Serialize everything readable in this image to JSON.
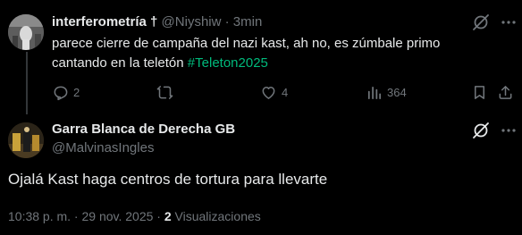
{
  "reply": {
    "display_name": "interferometría †",
    "handle": "@Niyshiw",
    "separator": "·",
    "time": "3min",
    "text_line1": "parece cierre de campaña del nazi kast, ah no, es zúmbale primo",
    "text_line2": "cantando en la teletón",
    "hashtag": "#Teleton2025",
    "actions": {
      "replies": "2",
      "retweets": "",
      "likes": "4",
      "views": "364"
    }
  },
  "main_post": {
    "display_name": "Garra Blanca de Derecha GB",
    "handle": "@MalvinasIngles",
    "text": "Ojalá Kast haga centros de tortura para llevarte",
    "timestamp": "10:38 p. m. · 29 nov. 2025 ·",
    "views_count": "2",
    "views_label": "Visualizaciones"
  },
  "colors": {
    "background": "#000000",
    "text": "#e7e9ea",
    "muted": "#71767b",
    "hashtag": "#00ba7c",
    "thread_line": "#333639"
  },
  "icons": {
    "grok": "grok-icon",
    "more": "more-options-icon",
    "reply": "reply-icon",
    "retweet": "retweet-icon",
    "like": "heart-icon",
    "views": "views-bar-icon",
    "bookmark": "bookmark-icon",
    "share": "share-icon"
  }
}
